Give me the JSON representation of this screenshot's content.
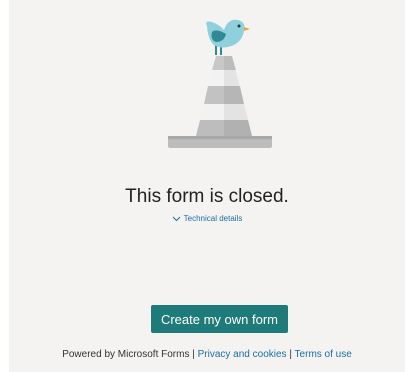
{
  "message": {
    "title": "This form is closed.",
    "details_link": "Technical details"
  },
  "actions": {
    "create_label": "Create my own form"
  },
  "footer": {
    "powered_by": "Powered by Microsoft Forms",
    "separator_1": " | ",
    "privacy_link": "Privacy and cookies",
    "separator_2": " | ",
    "terms_link": "Terms of use"
  },
  "icons": {
    "illustration": "bird-on-traffic-cone-icon",
    "details_toggle": "chevron-down-icon"
  },
  "colors": {
    "background": "#f4f3f2",
    "button": "#1e7b7a",
    "link": "#1b6ea6",
    "bird": "#7fc8d6"
  }
}
